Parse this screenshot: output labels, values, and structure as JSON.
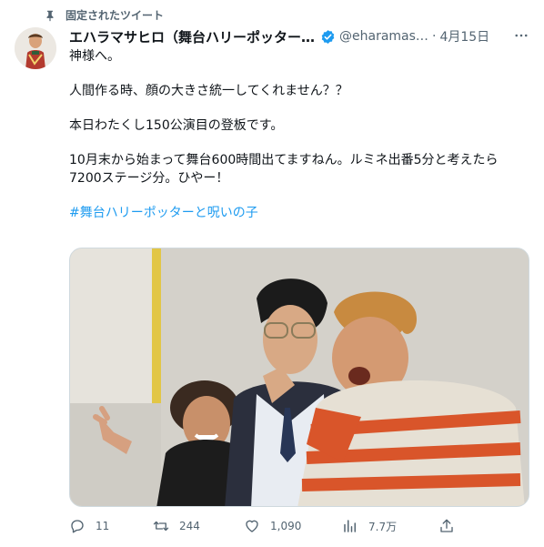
{
  "pinned": {
    "label": "固定されたツイート"
  },
  "author": {
    "name": "エハラマサヒロ（舞台ハリーポッター...",
    "handle": "@eharamasa...",
    "separator": "·",
    "date": "4月15日"
  },
  "tweet": {
    "lines": [
      "神様へ。",
      "人間作る時、顔の大きさ統一してくれません？？",
      "本日わたくし150公演目の登板です。",
      "10月末から始まって舞台600時間出てますねん。ルミネ出番5分と考えたら",
      "7200ステージ分。ひやー！"
    ],
    "hashtag": "#舞台ハリーポッターと呪いの子"
  },
  "metrics": {
    "replies": "11",
    "retweets": "244",
    "likes": "1,090",
    "views": "7.7万"
  },
  "colors": {
    "text": "#0f1419",
    "secondary": "#536471",
    "link": "#1d9bf0",
    "verified": "#1d9bf0"
  },
  "icons": [
    "pin-icon",
    "verified-badge-icon",
    "more-icon",
    "reply-icon",
    "retweet-icon",
    "like-icon",
    "views-icon",
    "share-icon"
  ]
}
